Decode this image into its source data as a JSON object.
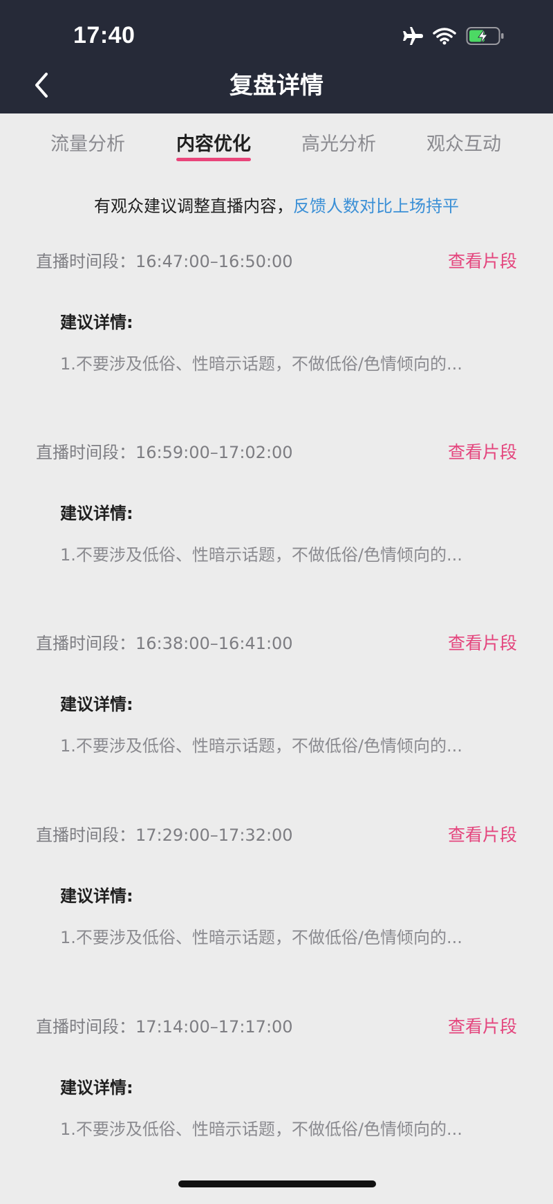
{
  "status_bar": {
    "time": "17:40",
    "icons": [
      "airplane-icon",
      "wifi-icon",
      "battery-charging-icon"
    ]
  },
  "nav": {
    "title": "复盘详情",
    "back_icon": "chevron-left-icon"
  },
  "tabs": [
    {
      "label": "流量分析",
      "active": false
    },
    {
      "label": "内容优化",
      "active": true
    },
    {
      "label": "高光分析",
      "active": false
    },
    {
      "label": "观众互动",
      "active": false
    }
  ],
  "summary": {
    "text": "有观众建议调整直播内容，",
    "highlight": "反馈人数对比上场持平"
  },
  "segments": [
    {
      "time": "直播时间段：16:47:00–16:50:00",
      "link": "查看片段",
      "advice_label": "建议详情:",
      "advice_text": "1.不要涉及低俗、性暗示话题，不做低俗/色情倾向的..."
    },
    {
      "time": "直播时间段：16:59:00–17:02:00",
      "link": "查看片段",
      "advice_label": "建议详情:",
      "advice_text": "1.不要涉及低俗、性暗示话题，不做低俗/色情倾向的..."
    },
    {
      "time": "直播时间段：16:38:00–16:41:00",
      "link": "查看片段",
      "advice_label": "建议详情:",
      "advice_text": "1.不要涉及低俗、性暗示话题，不做低俗/色情倾向的..."
    },
    {
      "time": "直播时间段：17:29:00–17:32:00",
      "link": "查看片段",
      "advice_label": "建议详情:",
      "advice_text": "1.不要涉及低俗、性暗示话题，不做低俗/色情倾向的..."
    },
    {
      "time": "直播时间段：17:14:00–17:17:00",
      "link": "查看片段",
      "advice_label": "建议详情:",
      "advice_text": "1.不要涉及低俗、性暗示话题，不做低俗/色情倾向的..."
    }
  ],
  "colors": {
    "header_bg": "#262a38",
    "page_bg": "#ececec",
    "accent_pink": "#e4457d",
    "link_blue": "#3a8fd6",
    "battery_green": "#4cd964"
  }
}
